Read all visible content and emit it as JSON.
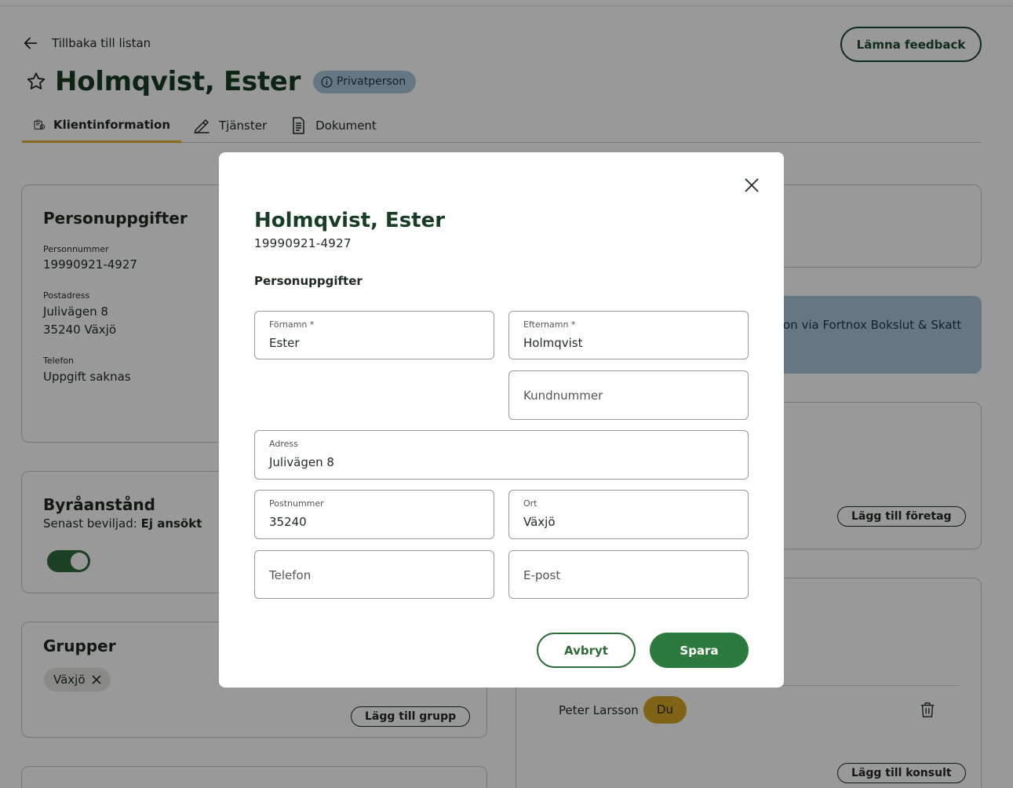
{
  "header": {
    "back_label": "Tillbaka till listan",
    "feedback_label": "Lämna feedback",
    "client_name": "Holmqvist, Ester",
    "client_type_badge": "Privatperson"
  },
  "tabs": [
    {
      "label": "Klientinformation",
      "icon": "client-info-icon",
      "active": true
    },
    {
      "label": "Tjänster",
      "icon": "services-icon",
      "active": false
    },
    {
      "label": "Dokument",
      "icon": "document-icon",
      "active": false
    }
  ],
  "personal_card": {
    "title": "Personuppgifter",
    "pnr_label": "Personnummer",
    "pnr_value": "19990921-4927",
    "address_label": "Postadress",
    "address_line1": "Julivägen 8",
    "address_line2": "35240 Växjö",
    "phone_label": "Telefon",
    "phone_value": "Uppgift saknas"
  },
  "bureau_card": {
    "title": "Byråanstånd",
    "granted_prefix": "Senast beviljad:",
    "granted_value": "Ej ansökt",
    "toggle_on": true
  },
  "groups_card": {
    "title": "Grupper",
    "chip_label": "Växjö",
    "add_group_label": "Lägg till grupp"
  },
  "right_column": {
    "info_text": "on via Fortnox Bokslut & Skatt",
    "add_company_label": "Lägg till företag",
    "consultant_name": "Peter Larsson",
    "consultant_badge": "Du",
    "add_consultant_label": "Lägg till konsult"
  },
  "modal": {
    "title": "Holmqvist, Ester",
    "pnr": "19990921-4927",
    "section_title": "Personuppgifter",
    "fields": {
      "first_name": {
        "label": "Förnamn *",
        "value": "Ester"
      },
      "last_name": {
        "label": "Efternamn *",
        "value": "Holmqvist"
      },
      "customer_number": {
        "placeholder": "Kundnummer"
      },
      "address": {
        "label": "Adress",
        "value": "Julivägen 8"
      },
      "postal_code": {
        "label": "Postnummer",
        "value": "35240"
      },
      "city": {
        "label": "Ort",
        "value": "Växjö"
      },
      "phone": {
        "placeholder": "Telefon"
      },
      "email": {
        "placeholder": "E-post"
      }
    },
    "cancel_label": "Avbryt",
    "save_label": "Spara"
  },
  "colors": {
    "brand_dark_green": "#173d24",
    "primary_green": "#2d7a3e",
    "accent_yellow": "#e3b22f",
    "info_blue": "#a8c7db"
  }
}
